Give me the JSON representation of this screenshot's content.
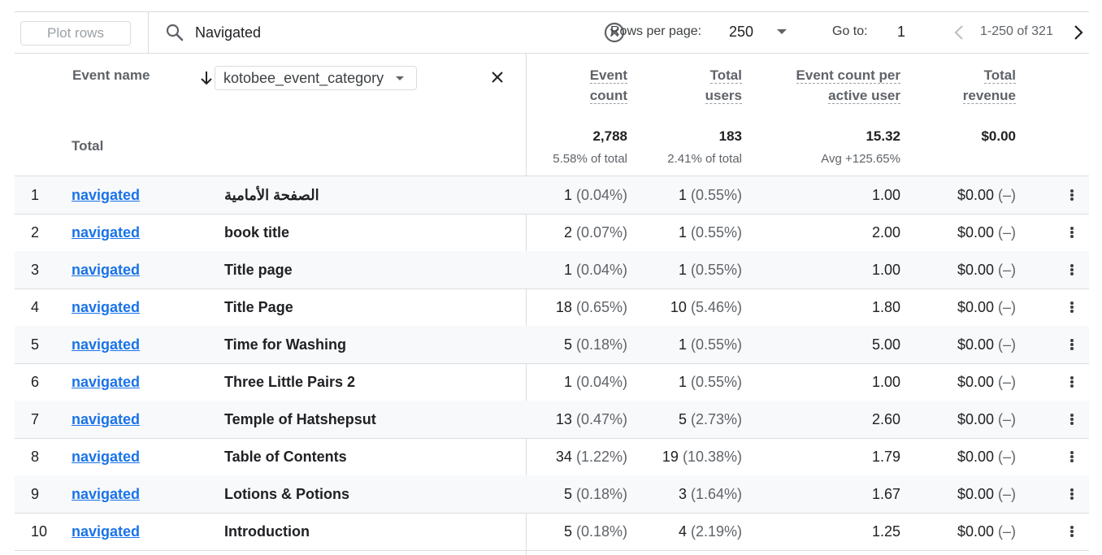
{
  "toolbar": {
    "plot_rows_label": "Plot rows",
    "search_value": "Navigated",
    "rows_per_page_label": "Rows per page:",
    "rows_per_page_value": "250",
    "go_to_label": "Go to:",
    "go_to_value": "1",
    "range_text": "1-250 of 321"
  },
  "header": {
    "dimension_label": "Event name",
    "secondary_dimension": "kotobee_event_category",
    "metrics": [
      {
        "line1": "Event",
        "line2": "count"
      },
      {
        "line1": "Total",
        "line2": "users"
      },
      {
        "line1": "Event count per",
        "line2": "active user"
      },
      {
        "line1": "Total",
        "line2": "revenue"
      }
    ]
  },
  "totals": {
    "label": "Total",
    "values": [
      "2,788",
      "183",
      "15.32",
      "$0.00"
    ],
    "subtexts": [
      "5.58% of total",
      "2.41% of total",
      "Avg +125.65%",
      ""
    ]
  },
  "rows": [
    {
      "index": "1",
      "event": "navigated",
      "category": "الصفحة الأمامية",
      "count": "1",
      "count_pct": "(0.04%)",
      "users": "1",
      "users_pct": "(0.55%)",
      "per_user": "1.00",
      "revenue": "$0.00",
      "revenue_pct": "(–)"
    },
    {
      "index": "2",
      "event": "navigated",
      "category": "book title",
      "count": "2",
      "count_pct": "(0.07%)",
      "users": "1",
      "users_pct": "(0.55%)",
      "per_user": "2.00",
      "revenue": "$0.00",
      "revenue_pct": "(–)"
    },
    {
      "index": "3",
      "event": "navigated",
      "category": "Title page",
      "count": "1",
      "count_pct": "(0.04%)",
      "users": "1",
      "users_pct": "(0.55%)",
      "per_user": "1.00",
      "revenue": "$0.00",
      "revenue_pct": "(–)"
    },
    {
      "index": "4",
      "event": "navigated",
      "category": "Title Page",
      "count": "18",
      "count_pct": "(0.65%)",
      "users": "10",
      "users_pct": "(5.46%)",
      "per_user": "1.80",
      "revenue": "$0.00",
      "revenue_pct": "(–)"
    },
    {
      "index": "5",
      "event": "navigated",
      "category": "Time for Washing",
      "count": "5",
      "count_pct": "(0.18%)",
      "users": "1",
      "users_pct": "(0.55%)",
      "per_user": "5.00",
      "revenue": "$0.00",
      "revenue_pct": "(–)"
    },
    {
      "index": "6",
      "event": "navigated",
      "category": "Three Little Pairs 2",
      "count": "1",
      "count_pct": "(0.04%)",
      "users": "1",
      "users_pct": "(0.55%)",
      "per_user": "1.00",
      "revenue": "$0.00",
      "revenue_pct": "(–)"
    },
    {
      "index": "7",
      "event": "navigated",
      "category": "Temple of Hatshepsut",
      "count": "13",
      "count_pct": "(0.47%)",
      "users": "5",
      "users_pct": "(2.73%)",
      "per_user": "2.60",
      "revenue": "$0.00",
      "revenue_pct": "(–)"
    },
    {
      "index": "8",
      "event": "navigated",
      "category": "Table of Contents",
      "count": "34",
      "count_pct": "(1.22%)",
      "users": "19",
      "users_pct": "(10.38%)",
      "per_user": "1.79",
      "revenue": "$0.00",
      "revenue_pct": "(–)"
    },
    {
      "index": "9",
      "event": "navigated",
      "category": "Lotions & Potions",
      "count": "5",
      "count_pct": "(0.18%)",
      "users": "3",
      "users_pct": "(1.64%)",
      "per_user": "1.67",
      "revenue": "$0.00",
      "revenue_pct": "(–)"
    },
    {
      "index": "10",
      "event": "navigated",
      "category": "Introduction",
      "count": "5",
      "count_pct": "(0.18%)",
      "users": "4",
      "users_pct": "(2.19%)",
      "per_user": "1.25",
      "revenue": "$0.00",
      "revenue_pct": "(–)"
    }
  ]
}
